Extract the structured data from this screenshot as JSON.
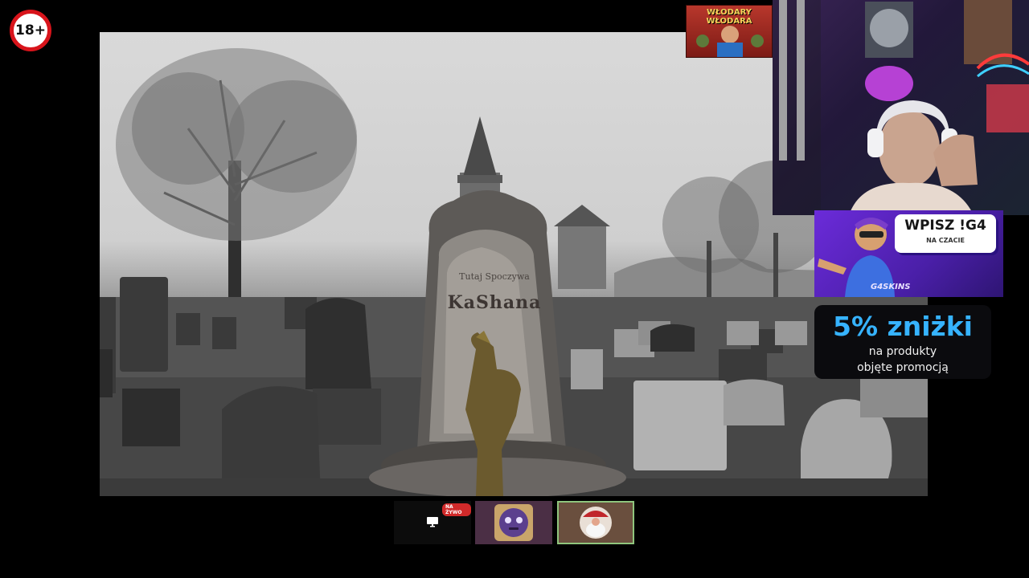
{
  "overlay": {
    "age_rating": "18+"
  },
  "scene": {
    "epitaph_top": "Tutaj Spoczywa",
    "epitaph_name": "KaShana"
  },
  "sticker": {
    "line1": "WŁODARY",
    "line2": "WŁODARA"
  },
  "promo": {
    "command": "WPISZ !G4",
    "chat_label": "NA CZACIE",
    "brand": "G4SKINS",
    "accent": "#6b2bd9"
  },
  "discount": {
    "title": "5% zniżki",
    "line1": "na produkty",
    "line2": "objęte promocją",
    "accent": "#36b3ff"
  },
  "tiles": [
    {
      "badge": "NA ŻYWO",
      "icon": "screen-share-icon"
    },
    {
      "icon": "avatar-face-icon"
    },
    {
      "icon": "avatar-santa-icon"
    }
  ]
}
